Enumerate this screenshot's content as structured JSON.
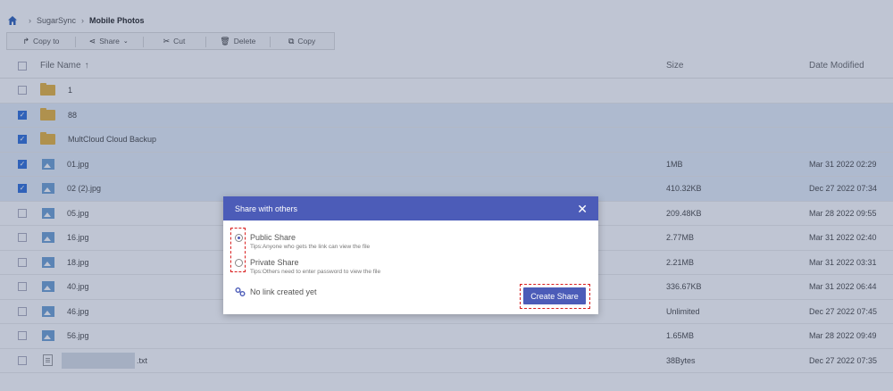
{
  "breadcrumb": {
    "home_icon": "home-icon",
    "items": [
      "SugarSync",
      "Mobile Photos"
    ]
  },
  "toolbar": {
    "copy_to": "Copy to",
    "share": "Share",
    "cut": "Cut",
    "delete": "Delete",
    "copy": "Copy"
  },
  "table": {
    "headers": {
      "name": "File Name",
      "sort_indicator": "↑",
      "size": "Size",
      "date": "Date Modified"
    },
    "rows": [
      {
        "name": "1",
        "type": "folder",
        "size": "",
        "date": "",
        "checked": false
      },
      {
        "name": "88",
        "type": "folder",
        "size": "",
        "date": "",
        "checked": true
      },
      {
        "name": "MultCloud Cloud Backup",
        "type": "folder",
        "size": "",
        "date": "",
        "checked": true
      },
      {
        "name": "01.jpg",
        "type": "image",
        "size": "1MB",
        "date": "Mar 31 2022 02:29",
        "checked": true
      },
      {
        "name": "02 (2).jpg",
        "type": "image",
        "size": "410.32KB",
        "date": "Dec 27 2022 07:34",
        "checked": true
      },
      {
        "name": "05.jpg",
        "type": "image",
        "size": "209.48KB",
        "date": "Mar 28 2022 09:55",
        "checked": false
      },
      {
        "name": "16.jpg",
        "type": "image",
        "size": "2.77MB",
        "date": "Mar 31 2022 02:40",
        "checked": false
      },
      {
        "name": "18.jpg",
        "type": "image",
        "size": "2.21MB",
        "date": "Mar 31 2022 03:31",
        "checked": false
      },
      {
        "name": "40.jpg",
        "type": "image",
        "size": "336.67KB",
        "date": "Mar 31 2022 06:44",
        "checked": false
      },
      {
        "name": "46.jpg",
        "type": "image",
        "size": "Unlimited",
        "date": "Dec 27 2022 07:45",
        "checked": false
      },
      {
        "name": "56.jpg",
        "type": "image",
        "size": "1.65MB",
        "date": "Mar 28 2022 09:49",
        "checked": false
      },
      {
        "name": ".txt",
        "type": "text",
        "size": "38Bytes",
        "date": "Dec 27 2022 07:35",
        "checked": false
      }
    ]
  },
  "modal": {
    "title": "Share with others",
    "public_label": "Public Share",
    "public_tip": "Tips:Anyone who gets the link can view the file",
    "private_label": "Private Share",
    "private_tip": "Tips:Others need to enter password to view the file",
    "no_link": "No link created yet",
    "create_button": "Create Share",
    "selected_option": "public"
  },
  "colors": {
    "accent": "#4c5cb8",
    "checkbox": "#2b6cd9",
    "folder": "#e7b23a",
    "highlight": "#d91f1f"
  }
}
